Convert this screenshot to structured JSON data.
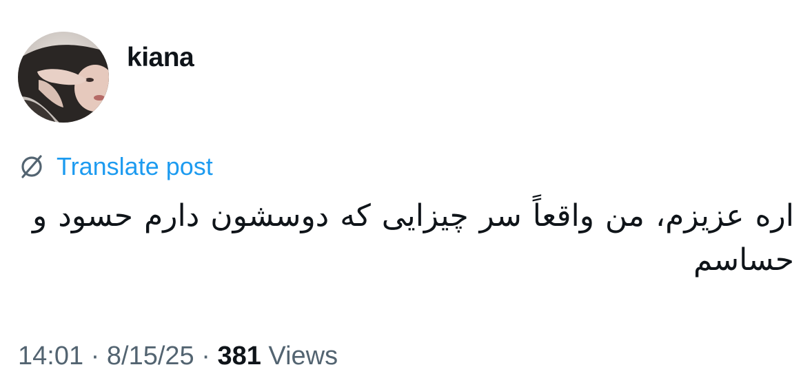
{
  "author": {
    "display_name": "kiana"
  },
  "translate": {
    "label": "Translate post",
    "icon": "globe-slash-icon"
  },
  "post": {
    "text": "اره عزیزم، من واقعاً سر چیزایی که دوسشون دارم حسود و حساسم"
  },
  "meta": {
    "time": "14:01",
    "separator": "·",
    "date": "8/15/25",
    "views_count": "381",
    "views_label": "Views"
  },
  "colors": {
    "link": "#1d9bf0",
    "text": "#0f1419",
    "muted": "#536471"
  }
}
